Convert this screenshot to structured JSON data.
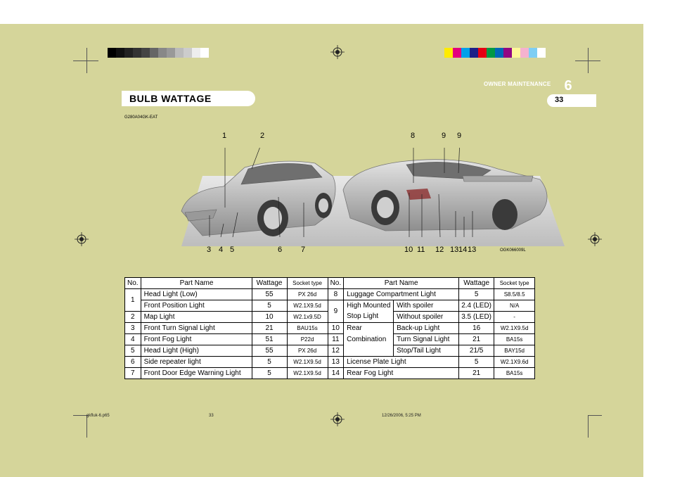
{
  "header": {
    "section": "OWNER MAINTENANCE",
    "chapter": "6",
    "page": "33"
  },
  "title": "BULB WATTAGE",
  "doc_code": "G280A04GK-EAT",
  "image_code": "OGK066009L",
  "figure_labels_front": [
    "1",
    "2",
    "3",
    "4",
    "5",
    "6",
    "7"
  ],
  "figure_labels_rear": [
    "8",
    "9",
    "9",
    "10",
    "11",
    "12",
    "13",
    "14",
    "13"
  ],
  "table": {
    "headers": {
      "no": "No.",
      "part_name": "Part Name",
      "wattage": "Wattage",
      "socket_type": "Socket type"
    },
    "left_rows": [
      {
        "no": "1",
        "name": "Head Light (Low)",
        "wattage": "55",
        "socket": "PX 26d"
      },
      {
        "no": "",
        "name": "Front Position Light",
        "wattage": "5",
        "socket": "W2.1X9.5d"
      },
      {
        "no": "2",
        "name": "Map Light",
        "wattage": "10",
        "socket": "W2.1x9.5D"
      },
      {
        "no": "3",
        "name": "Front Turn Signal Light",
        "wattage": "21",
        "socket": "BAU15s"
      },
      {
        "no": "4",
        "name": "Front Fog Light",
        "wattage": "51",
        "socket": "P22d"
      },
      {
        "no": "5",
        "name": "Head Light (High)",
        "wattage": "55",
        "socket": "PX 26d"
      },
      {
        "no": "6",
        "name": "Side repeater light",
        "wattage": "5",
        "socket": "W2.1X9.5d"
      },
      {
        "no": "7",
        "name": "Front Door Edge Warning Light",
        "wattage": "5",
        "socket": "W2.1X9.5d"
      }
    ],
    "right_rows": [
      {
        "no": "8",
        "name": "Luggage Compartment Light",
        "sub": "",
        "wattage": "5",
        "socket": "S8.5/8.5"
      },
      {
        "no": "9",
        "name": "High Mounted",
        "sub": "With spoiler",
        "wattage": "2.4 (LED)",
        "socket": "N/A"
      },
      {
        "no": "",
        "name": "Stop Light",
        "sub": "Without spoiler",
        "wattage": "3.5 (LED)",
        "socket": "-"
      },
      {
        "no": "10",
        "name": "Rear",
        "sub": "Back-up Light",
        "wattage": "16",
        "socket": "W2.1X9.5d"
      },
      {
        "no": "11",
        "name": "Combination",
        "sub": "Turn Signal Light",
        "wattage": "21",
        "socket": "BA15s"
      },
      {
        "no": "12",
        "name": "",
        "sub": "Stop/Tail Light",
        "wattage": "21/5",
        "socket": "BAY15d"
      },
      {
        "no": "13",
        "name": "License Plate Light",
        "sub": "",
        "wattage": "5",
        "socket": "W2.1X9.6d"
      },
      {
        "no": "14",
        "name": "Rear Fog Light",
        "sub": "",
        "wattage": "21",
        "socket": "BA15s"
      }
    ]
  },
  "footer": {
    "file": "gkfluk-6.p65",
    "page": "33",
    "timestamp": "12/26/2006, 5:25 PM"
  },
  "colors": {
    "page_bg": "#d5d59a",
    "white": "#ffffff"
  },
  "icons": {
    "registration": "registration-mark-icon"
  }
}
